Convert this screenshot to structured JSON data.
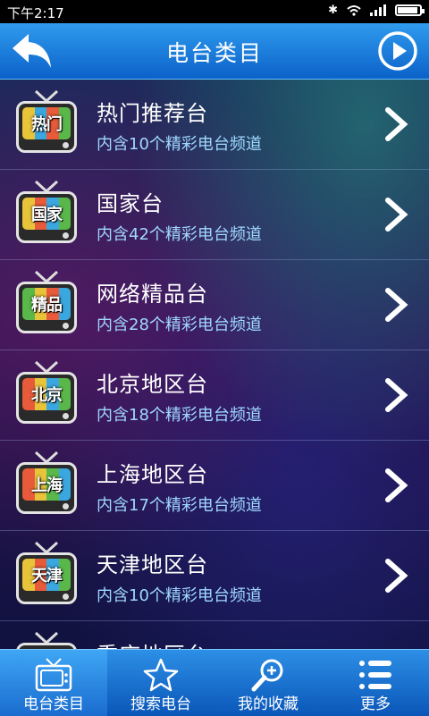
{
  "status_bar": {
    "time": "下午2:17"
  },
  "header": {
    "title": "电台类目"
  },
  "categories": [
    {
      "badge": "热门",
      "name": "热门推荐台",
      "desc": "内含10个精彩电台频道"
    },
    {
      "badge": "国家",
      "name": "国家台",
      "desc": "内含42个精彩电台频道"
    },
    {
      "badge": "精品",
      "name": "网络精品台",
      "desc": "内含28个精彩电台频道"
    },
    {
      "badge": "北京",
      "name": "北京地区台",
      "desc": "内含18个精彩电台频道"
    },
    {
      "badge": "上海",
      "name": "上海地区台",
      "desc": "内含17个精彩电台频道"
    },
    {
      "badge": "天津",
      "name": "天津地区台",
      "desc": "内含10个精彩电台频道"
    },
    {
      "badge": "",
      "name": "重庆地区台",
      "desc": ""
    }
  ],
  "tabs": [
    {
      "label": "电台类目",
      "icon": "tv-icon"
    },
    {
      "label": "搜索电台",
      "icon": "star-icon"
    },
    {
      "label": "我的收藏",
      "icon": "magnifier-plus-icon"
    },
    {
      "label": "更多",
      "icon": "list-menu-icon"
    }
  ],
  "colors": {
    "header_top": "#2f9bee",
    "header_bottom": "#0b62c9",
    "sub_text": "#9fd8ff"
  }
}
